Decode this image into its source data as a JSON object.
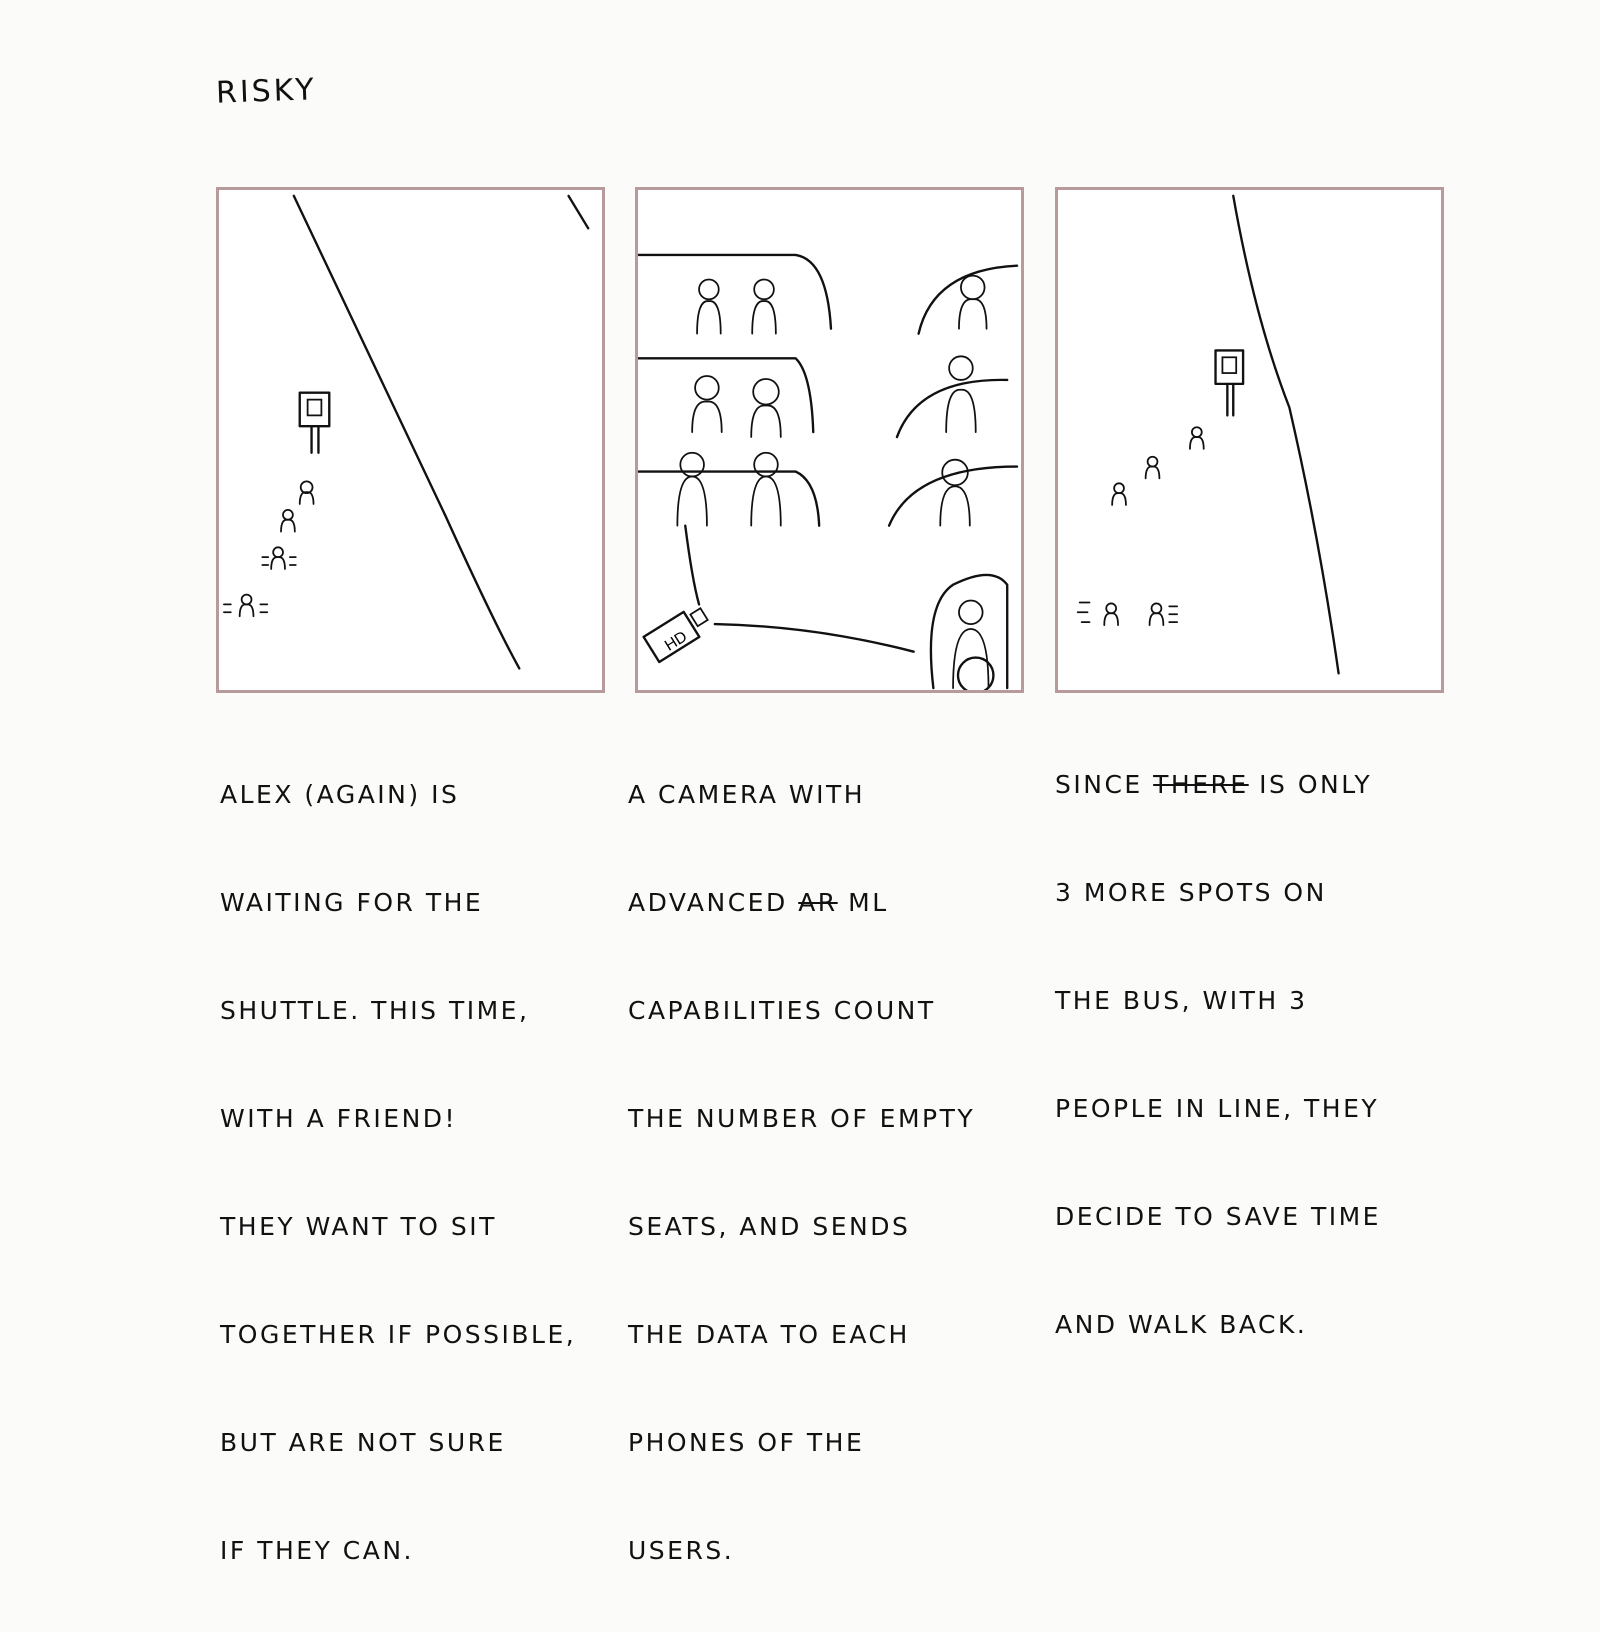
{
  "title": "RISKY",
  "panels": [
    {
      "caption_lines": [
        "ALEX (AGAIN) IS",
        "WAITING FOR THE",
        "SHUTTLE. THIS TIME,",
        "WITH A FRIEND!",
        "THEY WANT TO SIT",
        "TOGETHER IF POSSIBLE,",
        "BUT ARE NOT SURE",
        "IF THEY CAN."
      ]
    },
    {
      "camera_label": "HD",
      "caption_lines": [
        "A CAMERA WITH",
        "ADVANCED",
        "CAPABILITIES COUNT",
        "THE NUMBER OF EMPTY",
        "SEATS, AND SENDS",
        "THE DATA TO EACH",
        "PHONES OF THE",
        "USERS."
      ],
      "caption_struck": "AR",
      "caption_after_strike": "ML"
    },
    {
      "caption_line1_a": "SINCE",
      "caption_line1_struck": "THERE",
      "caption_line1_b": "IS ONLY",
      "caption_lines": [
        "3 MORE SPOTS ON",
        "THE BUS, WITH 3",
        "PEOPLE IN LINE, THEY",
        "DECIDE TO SAVE TIME",
        "AND WALK BACK."
      ]
    }
  ]
}
